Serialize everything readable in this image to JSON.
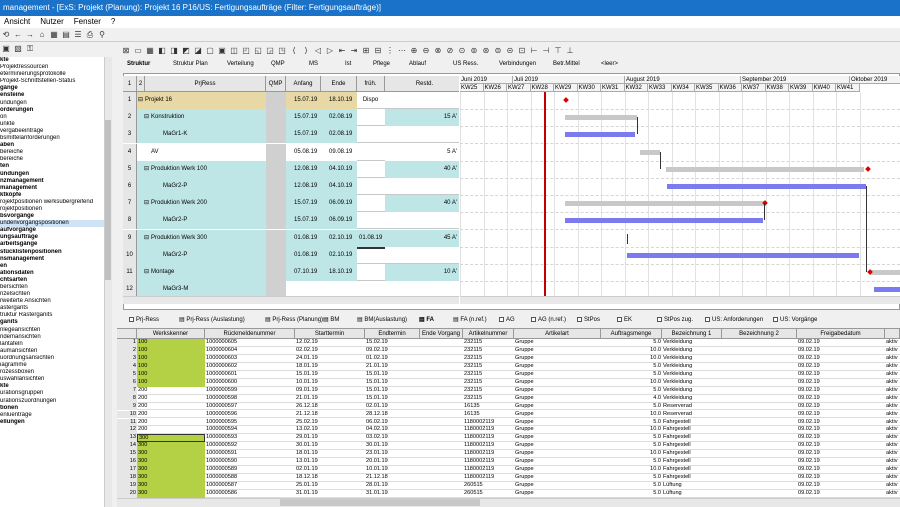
{
  "window": {
    "title": "management - [ExS: Projekt (Planung): Projekt 16 P16/US: Fertigungsaufträge (Filter: Fertigungsaufträge)]"
  },
  "menu": [
    "Ansicht",
    "Nutzer",
    "Fenster",
    "?"
  ],
  "sidebar": {
    "items": [
      {
        "label": "kte",
        "bold": true
      },
      {
        "label": "Projektressourcen"
      },
      {
        "label": "eterminierungsprotokolle"
      },
      {
        "label": "Projekt-Schnittstellen-Status"
      },
      {
        "label": "gänge",
        "bold": true
      },
      {
        "label": "ensteine",
        "bold": true
      },
      {
        "label": "ündungen"
      },
      {
        "label": "orderungen",
        "bold": true
      },
      {
        "label": "on"
      },
      {
        "label": "unkte"
      },
      {
        "label": "vergabeeinträge"
      },
      {
        "label": "bsmittelanforderungen"
      },
      {
        "label": "aben",
        "bold": true
      },
      {
        "label": "bereiche"
      },
      {
        "label": "bereiche"
      },
      {
        "label": "ten",
        "bold": true
      },
      {
        "label": "ündungen",
        "bold": true
      },
      {
        "label": "nzmanagement",
        "bold": true
      },
      {
        "label": "management",
        "bold": true
      },
      {
        "label": "ktköpfe",
        "bold": true
      },
      {
        "label": "rojektpositionen werksübergreifend"
      },
      {
        "label": "rojektpositionen"
      },
      {
        "label": "bsvorgänge",
        "bold": true
      },
      {
        "label": "undenvorgangspositionen",
        "selected": true
      },
      {
        "label": "aufvorgänge",
        "bold": true
      },
      {
        "label": "ungsaufträge",
        "bold": true
      },
      {
        "label": "arbeitsgänge",
        "bold": true
      },
      {
        "label": "stücklistenpositionen",
        "bold": true
      },
      {
        "label": "nsmanagement",
        "bold": true
      },
      {
        "label": "en",
        "bold": true
      },
      {
        "label": "ationsdaten",
        "bold": true
      },
      {
        "label": "chtsarten",
        "bold": true
      },
      {
        "label": "bersichten"
      },
      {
        "label": "nzelsichten"
      },
      {
        "label": "rweiterte Ansichten"
      },
      {
        "label": "astergants"
      },
      {
        "label": "truktur Rasterganits"
      },
      {
        "label": "ganits",
        "bold": true
      },
      {
        "label": "nlegeansichten"
      },
      {
        "label": "ndemansichten"
      },
      {
        "label": "lantafeln"
      },
      {
        "label": "aumansichten"
      },
      {
        "label": "uordnungsansichten"
      },
      {
        "label": "iagramme"
      },
      {
        "label": "rozessboxen"
      },
      {
        "label": "uswahlansichten"
      },
      {
        "label": "kte",
        "bold": true
      },
      {
        "label": "urationsgruppen"
      },
      {
        "label": "urationszuordnungen"
      },
      {
        "label": "tionen",
        "bold": true
      },
      {
        "label": "enluenträge"
      },
      {
        "label": "ellungen",
        "bold": true
      }
    ]
  },
  "upper_tabs": [
    "Struktur",
    "Struktur Plan",
    "Verteilung",
    "QMP",
    "MS",
    "Ist",
    "Pflege",
    "Ablauf",
    "US Ress.",
    "Verbindungen",
    "Betr.Mittel",
    "<leer>"
  ],
  "upper_grid": {
    "headers": [
      "1",
      "2",
      "PrjRess",
      "QMP",
      "Anfang",
      "Ende",
      "früh. Dispo",
      "Restd."
    ],
    "rows": [
      {
        "n": "1",
        "label": "Projekt 16",
        "anfang": "15.07.19",
        "ende": "18.10.19",
        "dispo": "",
        "rest": "",
        "style": "tan",
        "indent": 0,
        "box": true
      },
      {
        "n": "2",
        "label": "Konstruktion",
        "anfang": "15.07.19",
        "ende": "02.08.19",
        "dispo": "",
        "rest": "15 A'",
        "style": "cyan",
        "indent": 1,
        "box": true
      },
      {
        "n": "3",
        "label": "MaGr1-K",
        "anfang": "15.07.19",
        "ende": "02.08.19",
        "dispo": "",
        "rest": "",
        "style": "cyan",
        "indent": 2,
        "box": false
      },
      {
        "n": "4",
        "label": "AV",
        "anfang": "05.08.19",
        "ende": "09.08.19",
        "dispo": "",
        "rest": "5 A'",
        "style": "white",
        "indent": 1,
        "box": false
      },
      {
        "n": "5",
        "label": "Produktion Werk 100",
        "anfang": "12.08.19",
        "ende": "04.10.19",
        "dispo": "",
        "rest": "40 A'",
        "style": "cyan",
        "indent": 1,
        "box": true
      },
      {
        "n": "6",
        "label": "MaGr2-P",
        "anfang": "12.08.19",
        "ende": "04.10.19",
        "dispo": "",
        "rest": "",
        "style": "cyan",
        "indent": 2,
        "box": false
      },
      {
        "n": "7",
        "label": "Produktion Werk 200",
        "anfang": "15.07.19",
        "ende": "06.09.19",
        "dispo": "",
        "rest": "40 A'",
        "style": "cyan",
        "indent": 1,
        "box": true
      },
      {
        "n": "8",
        "label": "MaGr2-P",
        "anfang": "15.07.19",
        "ende": "06.09.19",
        "dispo": "",
        "rest": "",
        "style": "cyan",
        "indent": 2,
        "box": false
      },
      {
        "n": "9",
        "label": "Produktion Werk 300",
        "anfang": "01.08.19",
        "ende": "02.10.19",
        "dispo": "01.08.19",
        "rest": "45 A'",
        "style": "cyan",
        "indent": 1,
        "box": true
      },
      {
        "n": "10",
        "label": "MaGr2-P",
        "anfang": "01.08.19",
        "ende": "02.10.19",
        "dispo": "",
        "rest": "",
        "style": "cyan",
        "indent": 2,
        "box": false
      },
      {
        "n": "11",
        "label": "Montage",
        "anfang": "07.10.19",
        "ende": "18.10.19",
        "dispo": "",
        "rest": "10 A'",
        "style": "cyan",
        "indent": 1,
        "box": true
      },
      {
        "n": "12",
        "label": "MaGr3-M",
        "anfang": "",
        "ende": "",
        "dispo": "",
        "rest": "",
        "style": "cyan",
        "indent": 2,
        "box": false
      }
    ]
  },
  "gantt": {
    "months": [
      "Juni 2019",
      "Juli 2019",
      "August 2019",
      "September 2019",
      "Oktober 2019"
    ],
    "weeks": [
      "KW25",
      "KW26",
      "KW27",
      "KW28",
      "KW29",
      "KW30",
      "KW31",
      "KW32",
      "KW33",
      "KW34",
      "KW35",
      "KW36",
      "KW37",
      "KW38",
      "KW39",
      "KW40",
      "KW41"
    ]
  },
  "lower_tabs": [
    {
      "label": "Prj-Ress",
      "check": true
    },
    {
      "label": "Prj-Ress (Auslastung)",
      "check": false
    },
    {
      "label": "Prj-Ress (Planung)",
      "check": false
    },
    {
      "label": "BM",
      "check": false
    },
    {
      "label": "BM(Auslastung)",
      "check": false
    },
    {
      "label": "FA",
      "check": false,
      "active": true
    },
    {
      "label": "FA (n.ref.)",
      "check": false
    },
    {
      "label": "AG",
      "check": true
    },
    {
      "label": "AG (n.ref.)",
      "check": true
    },
    {
      "label": "StPos",
      "check": true
    },
    {
      "label": "EK",
      "check": true
    },
    {
      "label": "StPos zug.",
      "check": true
    },
    {
      "label": "US: Anforderungen",
      "check": true
    },
    {
      "label": "US: Vorgänge",
      "check": true
    }
  ],
  "lower_grid": {
    "headers": [
      "",
      "Werkskenner",
      "Rückmeldenummer",
      "Starttermin",
      "Endtermin",
      "Ende Vorgang",
      "Artikelnummer",
      "Artikelart",
      "Auftragsmenge",
      "Bezeichnung 1",
      "Bezeichnung 2",
      "Freigabedatum",
      ""
    ],
    "rows": [
      [
        "1",
        "100",
        "1000000605",
        "12.02.19",
        "15.02.19",
        "",
        "232115",
        "Gruppe",
        "5.0",
        "Verkleidung",
        "",
        "09.02.19",
        "aktiv"
      ],
      [
        "2",
        "100",
        "1000000604",
        "02.02.19",
        "09.02.19",
        "",
        "232115",
        "Gruppe",
        "10.0",
        "Verkleidung",
        "",
        "09.02.19",
        "aktiv"
      ],
      [
        "3",
        "100",
        "1000000603",
        "24.01.19",
        "01.02.19",
        "",
        "232115",
        "Gruppe",
        "10.0",
        "Verkleidung",
        "",
        "09.02.19",
        "aktiv"
      ],
      [
        "4",
        "100",
        "1000000602",
        "18.01.19",
        "21.01.19",
        "",
        "232115",
        "Gruppe",
        "5.0",
        "Verkleidung",
        "",
        "09.02.19",
        "aktiv"
      ],
      [
        "5",
        "100",
        "1000000601",
        "15.01.19",
        "15.01.19",
        "",
        "232115",
        "Gruppe",
        "5.0",
        "Verkleidung",
        "",
        "09.02.19",
        "aktiv"
      ],
      [
        "6",
        "100",
        "1000000600",
        "10.01.19",
        "15.01.19",
        "",
        "232115",
        "Gruppe",
        "10.0",
        "Verkleidung",
        "",
        "09.02.19",
        "aktiv"
      ],
      [
        "7",
        "200",
        "1000000599",
        "09.01.19",
        "15.01.19",
        "",
        "232115",
        "Gruppe",
        "5.0",
        "Verkleidung",
        "",
        "09.02.19",
        "aktiv"
      ],
      [
        "8",
        "200",
        "1000000598",
        "21.01.19",
        "15.01.19",
        "",
        "232115",
        "Gruppe",
        "4.0",
        "Verkleidung",
        "",
        "09.02.19",
        "aktiv"
      ],
      [
        "9",
        "200",
        "1000000597",
        "26.12.18",
        "02.01.19",
        "",
        "16135",
        "Gruppe",
        "5.0",
        "Reserverad",
        "",
        "09.02.19",
        "aktiv"
      ],
      [
        "10",
        "200",
        "1000000596",
        "21.12.18",
        "28.12.18",
        "",
        "16135",
        "Gruppe",
        "10.0",
        "Reserverad",
        "",
        "09.02.19",
        "aktiv"
      ],
      [
        "11",
        "200",
        "1000000595",
        "25.02.19",
        "06.02.19",
        "",
        "1180002119",
        "Gruppe",
        "5.0",
        "Fahrgestell",
        "",
        "09.02.19",
        "aktiv"
      ],
      [
        "12",
        "200",
        "1000000594",
        "13.02.19",
        "04.02.19",
        "",
        "1180002119",
        "Gruppe",
        "10.0",
        "Fahrgestell",
        "",
        "09.02.19",
        "aktiv"
      ],
      [
        "13",
        "300",
        "1000000593",
        "29.01.19",
        "03.02.19",
        "",
        "1180002119",
        "Gruppe",
        "5.0",
        "Fahrgestell",
        "",
        "09.02.19",
        "aktiv"
      ],
      [
        "14",
        "300",
        "1000000592",
        "30.01.19",
        "30.01.19",
        "",
        "1180002119",
        "Gruppe",
        "5.0",
        "Fahrgestell",
        "",
        "09.02.19",
        "aktiv"
      ],
      [
        "15",
        "300",
        "1000000591",
        "18.01.19",
        "23.01.19",
        "",
        "1180002119",
        "Gruppe",
        "10.0",
        "Fahrgestell",
        "",
        "09.02.19",
        "aktiv"
      ],
      [
        "16",
        "300",
        "1000000590",
        "13.01.19",
        "20.01.19",
        "",
        "1180002119",
        "Gruppe",
        "5.0",
        "Fahrgestell",
        "",
        "09.02.19",
        "aktiv"
      ],
      [
        "17",
        "300",
        "1000000589",
        "02.01.19",
        "10.01.19",
        "",
        "1180002119",
        "Gruppe",
        "10.0",
        "Fahrgestell",
        "",
        "09.02.19",
        "aktiv"
      ],
      [
        "18",
        "300",
        "1000000588",
        "18.12.18",
        "21.12.18",
        "",
        "1180002119",
        "Gruppe",
        "5.0",
        "Fahrgestell",
        "",
        "09.02.19",
        "aktiv"
      ],
      [
        "19",
        "300",
        "1000000587",
        "25.01.19",
        "28.01.19",
        "",
        "260515",
        "Gruppe",
        "5.0",
        "Lüftung",
        "",
        "09.02.19",
        "aktiv"
      ],
      [
        "20",
        "300",
        "1000000586",
        "31.01.19",
        "31.01.19",
        "",
        "260515",
        "Gruppe",
        "5.0",
        "Lüftung",
        "",
        "09.02.19",
        "aktiv"
      ]
    ]
  },
  "colors": {
    "title_bar": "#1a73c8",
    "tan": "#e7d8a6",
    "cyan": "#bfe6e6",
    "green": "#b4d044",
    "today_line": "#c00000",
    "gantt_blue": "#7b7bef"
  }
}
